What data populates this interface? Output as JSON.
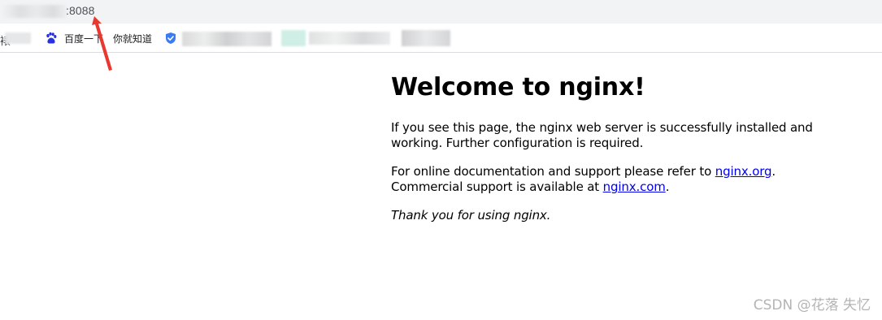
{
  "address_bar": {
    "url_visible": ":8088"
  },
  "bookmarks": {
    "fragment": "裱",
    "items": [
      {
        "label": "百度一下",
        "icon": "baidu-paw-icon"
      },
      {
        "label": "你就知道",
        "icon": ""
      }
    ],
    "shield_icon": "shield-check-icon"
  },
  "page": {
    "heading": "Welcome to nginx!",
    "para1": "If you see this page, the nginx web server is successfully installed and working. Further configuration is required.",
    "para2_prefix": "For online documentation and support please refer to ",
    "link1": "nginx.org",
    "para2_mid": ".",
    "para2_line2": "Commercial support is available at ",
    "link2": "nginx.com",
    "para2_end": ".",
    "para3": "Thank you for using nginx."
  },
  "watermark": "CSDN @花落 失忆",
  "colors": {
    "address_bar_bg": "#f1f3f4",
    "link": "#0000ee",
    "arrow": "#e8382f",
    "baidu_blue": "#2932e1",
    "shield_blue": "#3b7cf5"
  }
}
